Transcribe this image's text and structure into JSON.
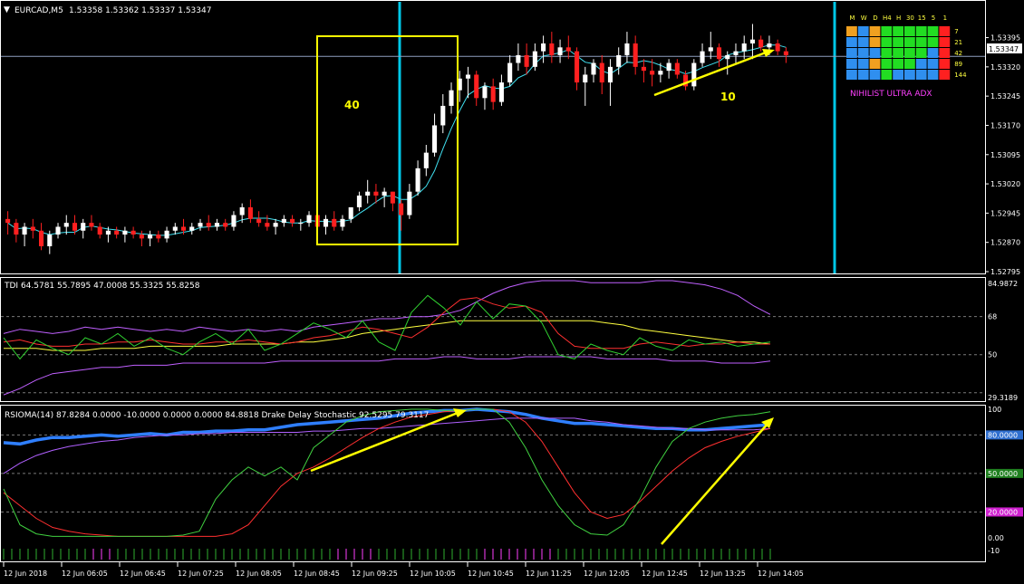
{
  "header": {
    "symbol": "EURCAD,M5",
    "ohlc": "1.53358 1.53362 1.53337 1.53347"
  },
  "price_axis": {
    "ticks": [
      "1.53395",
      "1.53320",
      "1.53245",
      "1.53170",
      "1.53095",
      "1.53020",
      "1.52945",
      "1.52870",
      "1.52795"
    ],
    "current_price": "1.53347",
    "current_color": "#ffffff"
  },
  "annotations": {
    "box_label": "40",
    "arrow_label": "10",
    "annotation_color": "#ffff00",
    "vline_color": "#00c8e8"
  },
  "adx_panel": {
    "title": "NIHILIST ULTRA ADX",
    "timeframes": [
      "M",
      "W",
      "D",
      "H4",
      "H",
      "30",
      "15",
      "5",
      "1"
    ],
    "periods": [
      "7",
      "21",
      "42",
      "89",
      "144"
    ],
    "grid": [
      [
        "o",
        "b",
        "o",
        "g",
        "g",
        "g",
        "g",
        "g",
        "r"
      ],
      [
        "b",
        "b",
        "o",
        "g",
        "g",
        "g",
        "g",
        "g",
        "r"
      ],
      [
        "b",
        "b",
        "b",
        "g",
        "g",
        "g",
        "g",
        "b",
        "r"
      ],
      [
        "b",
        "b",
        "o",
        "g",
        "g",
        "g",
        "b",
        "b",
        "r"
      ],
      [
        "b",
        "b",
        "b",
        "g",
        "b",
        "b",
        "b",
        "b",
        "r"
      ]
    ],
    "colors": {
      "o": "#f0a020",
      "b": "#2f8fef",
      "g": "#22dd22",
      "r": "#ff2020"
    }
  },
  "tdi": {
    "label": "TDI 64.5781 55.7895 47.0008 55.3325 55.8258",
    "ticks": [
      "84.9872",
      "68",
      "50",
      "29.3189"
    ]
  },
  "rsioma": {
    "label": "RSIOMA(14) 87.8284 0.0000 -10.0000 0.0000 0.0000 84.8818  Drake Delay Stochastic 92.5295 79.3117",
    "ticks": [
      "100",
      "80.0000",
      "50.0000",
      "20.0000",
      "0.00",
      "-10"
    ]
  },
  "time_axis": {
    "labels": [
      "12 Jun 2018",
      "12 Jun 06:05",
      "12 Jun 06:45",
      "12 Jun 07:25",
      "12 Jun 08:05",
      "12 Jun 08:45",
      "12 Jun 09:25",
      "12 Jun 10:05",
      "12 Jun 10:45",
      "12 Jun 11:25",
      "12 Jun 12:05",
      "12 Jun 12:45",
      "12 Jun 13:25",
      "12 Jun 14:05"
    ]
  },
  "chart_data": [
    {
      "type": "candlestick",
      "title": "EURCAD,M5",
      "bull_color": "#ffffff",
      "bear_color": "#ff2020",
      "ma_color": "#40e0f0",
      "ylim": [
        1.52795,
        1.53445
      ],
      "ohlc": [
        [
          1.5293,
          1.5295,
          1.5289,
          1.5292
        ],
        [
          1.5292,
          1.5293,
          1.5287,
          1.5289
        ],
        [
          1.5289,
          1.5292,
          1.5286,
          1.5291
        ],
        [
          1.5291,
          1.5293,
          1.5288,
          1.529
        ],
        [
          1.529,
          1.5292,
          1.5285,
          1.5286
        ],
        [
          1.5286,
          1.529,
          1.5284,
          1.5289
        ],
        [
          1.5289,
          1.5292,
          1.5288,
          1.5291
        ],
        [
          1.5291,
          1.5294,
          1.5289,
          1.5292
        ],
        [
          1.5292,
          1.5294,
          1.5289,
          1.529
        ],
        [
          1.529,
          1.5293,
          1.5288,
          1.5292
        ],
        [
          1.5292,
          1.5294,
          1.529,
          1.5291
        ],
        [
          1.5291,
          1.5292,
          1.5288,
          1.5289
        ],
        [
          1.5289,
          1.5291,
          1.5287,
          1.529
        ],
        [
          1.529,
          1.5291,
          1.5288,
          1.5289
        ],
        [
          1.5289,
          1.5291,
          1.5287,
          1.529
        ],
        [
          1.529,
          1.5291,
          1.5288,
          1.5289
        ],
        [
          1.5289,
          1.529,
          1.5286,
          1.5288
        ],
        [
          1.5288,
          1.529,
          1.5286,
          1.5289
        ],
        [
          1.5289,
          1.529,
          1.5287,
          1.5288
        ],
        [
          1.5288,
          1.5291,
          1.5287,
          1.529
        ],
        [
          1.529,
          1.5292,
          1.5289,
          1.5291
        ],
        [
          1.5291,
          1.5293,
          1.5289,
          1.529
        ],
        [
          1.529,
          1.5292,
          1.5289,
          1.5291
        ],
        [
          1.5291,
          1.5293,
          1.529,
          1.5292
        ],
        [
          1.5292,
          1.5294,
          1.529,
          1.5291
        ],
        [
          1.5291,
          1.5293,
          1.529,
          1.5292
        ],
        [
          1.5292,
          1.5293,
          1.529,
          1.5291
        ],
        [
          1.5291,
          1.5295,
          1.529,
          1.5294
        ],
        [
          1.5294,
          1.5297,
          1.5292,
          1.5296
        ],
        [
          1.5296,
          1.5298,
          1.5292,
          1.5293
        ],
        [
          1.5293,
          1.5295,
          1.5291,
          1.5292
        ],
        [
          1.5292,
          1.5294,
          1.529,
          1.5291
        ],
        [
          1.5291,
          1.5293,
          1.5289,
          1.5292
        ],
        [
          1.5292,
          1.5294,
          1.5291,
          1.5293
        ],
        [
          1.5293,
          1.5294,
          1.5291,
          1.5292
        ],
        [
          1.5292,
          1.5293,
          1.529,
          1.5292
        ],
        [
          1.5292,
          1.5295,
          1.5291,
          1.5294
        ],
        [
          1.5294,
          1.5296,
          1.529,
          1.5291
        ],
        [
          1.5291,
          1.5294,
          1.5289,
          1.5293
        ],
        [
          1.5293,
          1.5295,
          1.529,
          1.5291
        ],
        [
          1.5291,
          1.5294,
          1.529,
          1.5293
        ],
        [
          1.5293,
          1.5296,
          1.5292,
          1.5296
        ],
        [
          1.5296,
          1.53,
          1.5295,
          1.5299
        ],
        [
          1.5299,
          1.5303,
          1.5297,
          1.53
        ],
        [
          1.53,
          1.5302,
          1.5297,
          1.5299
        ],
        [
          1.5299,
          1.5301,
          1.5296,
          1.53
        ],
        [
          1.53,
          1.53,
          1.5295,
          1.5297
        ],
        [
          1.5297,
          1.5298,
          1.529,
          1.5294
        ],
        [
          1.5294,
          1.5302,
          1.5293,
          1.53
        ],
        [
          1.53,
          1.5308,
          1.5299,
          1.5306
        ],
        [
          1.5306,
          1.5312,
          1.5304,
          1.531
        ],
        [
          1.531,
          1.532,
          1.5309,
          1.5317
        ],
        [
          1.5317,
          1.5325,
          1.5315,
          1.5322
        ],
        [
          1.5322,
          1.5328,
          1.532,
          1.5326
        ],
        [
          1.5326,
          1.5331,
          1.5323,
          1.5329
        ],
        [
          1.5329,
          1.5332,
          1.5324,
          1.533
        ],
        [
          1.533,
          1.5331,
          1.5322,
          1.5324
        ],
        [
          1.5324,
          1.5328,
          1.5321,
          1.5327
        ],
        [
          1.5327,
          1.5329,
          1.5321,
          1.5323
        ],
        [
          1.5323,
          1.533,
          1.5322,
          1.5328
        ],
        [
          1.5328,
          1.5335,
          1.5327,
          1.5333
        ],
        [
          1.5333,
          1.5338,
          1.5331,
          1.5335
        ],
        [
          1.5335,
          1.5338,
          1.533,
          1.5332
        ],
        [
          1.5332,
          1.5338,
          1.5331,
          1.5336
        ],
        [
          1.5336,
          1.534,
          1.5333,
          1.5338
        ],
        [
          1.5338,
          1.5341,
          1.5333,
          1.5335
        ],
        [
          1.5335,
          1.5339,
          1.5333,
          1.5337
        ],
        [
          1.5337,
          1.534,
          1.5334,
          1.5336
        ],
        [
          1.5336,
          1.5337,
          1.5326,
          1.5328
        ],
        [
          1.5328,
          1.5332,
          1.5322,
          1.533
        ],
        [
          1.533,
          1.5334,
          1.5328,
          1.5333
        ],
        [
          1.5333,
          1.5335,
          1.5325,
          1.5328
        ],
        [
          1.5328,
          1.5334,
          1.5322,
          1.5332
        ],
        [
          1.5332,
          1.5337,
          1.533,
          1.5335
        ],
        [
          1.5335,
          1.5341,
          1.5333,
          1.5338
        ],
        [
          1.5338,
          1.534,
          1.533,
          1.5332
        ],
        [
          1.5332,
          1.5334,
          1.5328,
          1.5331
        ],
        [
          1.5331,
          1.5334,
          1.5327,
          1.533
        ],
        [
          1.533,
          1.5333,
          1.5328,
          1.5331
        ],
        [
          1.5331,
          1.5334,
          1.5329,
          1.5333
        ],
        [
          1.5333,
          1.5334,
          1.5329,
          1.533
        ],
        [
          1.533,
          1.5331,
          1.5326,
          1.5327
        ],
        [
          1.5327,
          1.5334,
          1.5326,
          1.5333
        ],
        [
          1.5333,
          1.5338,
          1.5332,
          1.5336
        ],
        [
          1.5336,
          1.5341,
          1.5334,
          1.5337
        ],
        [
          1.5337,
          1.5338,
          1.5332,
          1.5334
        ],
        [
          1.5334,
          1.5336,
          1.533,
          1.5335
        ],
        [
          1.5335,
          1.5338,
          1.5333,
          1.5336
        ],
        [
          1.5336,
          1.534,
          1.5334,
          1.5338
        ],
        [
          1.5338,
          1.5343,
          1.5334,
          1.5339
        ],
        [
          1.5339,
          1.534,
          1.5336,
          1.5337
        ],
        [
          1.5337,
          1.534,
          1.5335,
          1.5338
        ],
        [
          1.5338,
          1.5339,
          1.5335,
          1.5336
        ],
        [
          1.5336,
          1.5337,
          1.5333,
          1.5335
        ]
      ]
    },
    {
      "type": "line",
      "title": "TDI 64.5781 55.7895 47.0008 55.3325 55.8258",
      "ylim": [
        29.3189,
        84.9872
      ],
      "levels": [
        68,
        50,
        32
      ],
      "series": [
        {
          "color": "#c060ff",
          "values": [
            60,
            62,
            61,
            60,
            61,
            63,
            62,
            63,
            62,
            61,
            62,
            61,
            63,
            62,
            61,
            62,
            61,
            62,
            61,
            63,
            64,
            65,
            66,
            67,
            67,
            68,
            68,
            69,
            71,
            75,
            79,
            82,
            84,
            85,
            85,
            85,
            84,
            84,
            84,
            84,
            85,
            85,
            84,
            83,
            81,
            78,
            73,
            69
          ]
        },
        {
          "color": "#c060ff",
          "values": [
            31,
            34,
            38,
            41,
            42,
            43,
            44,
            44,
            45,
            45,
            45,
            46,
            46,
            46,
            46,
            46,
            46,
            47,
            47,
            47,
            47,
            47,
            47,
            47,
            48,
            48,
            48,
            49,
            49,
            48,
            48,
            48,
            49,
            49,
            49,
            49,
            49,
            48,
            48,
            48,
            48,
            47,
            47,
            47,
            46,
            46,
            46,
            47
          ]
        },
        {
          "color": "#ffff40",
          "values": [
            53,
            53,
            53,
            52,
            52,
            52,
            53,
            53,
            53,
            54,
            54,
            54,
            54,
            54,
            55,
            55,
            55,
            55,
            56,
            56,
            57,
            58,
            60,
            61,
            62,
            63,
            64,
            65,
            66,
            66,
            66,
            66,
            66,
            66,
            66,
            66,
            66,
            65,
            64,
            62,
            61,
            60,
            59,
            58,
            57,
            56,
            56,
            55
          ]
        },
        {
          "color": "#ff3030",
          "values": [
            56,
            57,
            55,
            54,
            54,
            55,
            55,
            56,
            56,
            57,
            56,
            55,
            55,
            56,
            56,
            57,
            56,
            55,
            56,
            58,
            59,
            61,
            63,
            62,
            60,
            58,
            63,
            70,
            76,
            77,
            74,
            72,
            73,
            70,
            60,
            54,
            53,
            53,
            53,
            55,
            56,
            55,
            54,
            55,
            55,
            56,
            55,
            55
          ]
        },
        {
          "color": "#30d030",
          "values": [
            58,
            48,
            57,
            53,
            50,
            58,
            55,
            60,
            54,
            58,
            53,
            50,
            56,
            60,
            55,
            62,
            52,
            55,
            60,
            65,
            62,
            58,
            66,
            56,
            52,
            70,
            78,
            72,
            64,
            75,
            67,
            74,
            73,
            65,
            50,
            48,
            55,
            52,
            50,
            58,
            54,
            52,
            57,
            55,
            56,
            54,
            55,
            56
          ]
        }
      ]
    },
    {
      "type": "line",
      "title": "RSIOMA(14) 87.8284 0.0000 -10.0000 0.0000 0.0000 84.8818  Drake Delay Stochastic 92.5295 79.3117",
      "ylim": [
        -10,
        100
      ],
      "levels": [
        80,
        50,
        20
      ],
      "series": [
        {
          "color": "#2f7fff",
          "values": [
            74,
            73,
            76,
            78,
            78,
            79,
            80,
            79,
            80,
            81,
            80,
            82,
            82,
            83,
            83,
            84,
            84,
            86,
            88,
            89,
            90,
            91,
            92,
            93,
            95,
            97,
            98,
            99,
            99,
            100,
            99,
            98,
            96,
            93,
            91,
            89,
            89,
            88,
            87,
            86,
            85,
            85,
            84,
            84,
            85,
            86,
            87,
            88
          ]
        },
        {
          "color": "#b060ff",
          "values": [
            50,
            58,
            64,
            68,
            71,
            73,
            75,
            76,
            78,
            79,
            80,
            80,
            81,
            81,
            82,
            82,
            82,
            82,
            82,
            83,
            83,
            84,
            85,
            85,
            86,
            87,
            88,
            89,
            90,
            91,
            92,
            93,
            93,
            93,
            93,
            93,
            91,
            90,
            88,
            87,
            86,
            85,
            85,
            84,
            84,
            84,
            84,
            85
          ]
        },
        {
          "color": "#ff3030",
          "values": [
            35,
            25,
            15,
            8,
            5,
            3,
            2,
            1,
            1,
            1,
            1,
            1,
            1,
            1,
            3,
            10,
            25,
            40,
            50,
            55,
            62,
            70,
            78,
            85,
            90,
            94,
            96,
            98,
            99,
            100,
            100,
            98,
            90,
            75,
            55,
            35,
            20,
            15,
            18,
            28,
            40,
            52,
            62,
            70,
            75,
            79,
            82,
            85
          ]
        },
        {
          "color": "#40d040",
          "values": [
            38,
            10,
            3,
            1,
            1,
            1,
            1,
            1,
            1,
            1,
            1,
            2,
            5,
            30,
            45,
            55,
            48,
            55,
            45,
            70,
            80,
            90,
            95,
            98,
            99,
            100,
            100,
            99,
            99,
            100,
            100,
            90,
            70,
            45,
            25,
            10,
            3,
            2,
            10,
            30,
            55,
            75,
            85,
            90,
            93,
            95,
            96,
            98
          ]
        }
      ]
    }
  ]
}
